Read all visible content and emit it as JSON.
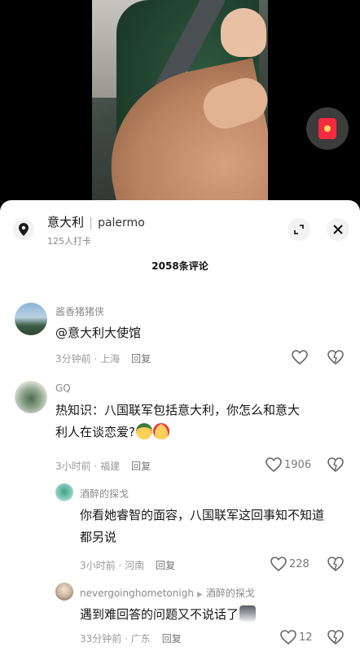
{
  "location": {
    "name": "意大利",
    "sub": "palermo",
    "checkins": "125人打卡"
  },
  "comment_count": "2058条评论",
  "comments": [
    {
      "user": "酱香猪猪侠",
      "text": "@意大利大使馆",
      "meta": "3分钟前 · 上海",
      "reply": "回复",
      "likes": ""
    },
    {
      "user": "GQ",
      "text": "热知识：八国联军包括意大利，你怎么和意大利人在谈恋爱?",
      "meta": "3小时前 · 福建",
      "reply": "回复",
      "likes": "1906"
    },
    {
      "user": "酒醉的探戈",
      "text": "你看她睿智的面容，八国联军这回事知不知道都另说",
      "meta": "3小时前 · 河南",
      "reply": "回复",
      "likes": "228"
    },
    {
      "user": "nevergoinghometonigh",
      "reply_to": "酒醉的探戈",
      "text": "遇到难回答的问题又不说话了",
      "meta": "33分钟前 · 广东",
      "reply": "回复",
      "likes": "12"
    }
  ],
  "colors": {
    "accent_red": "#f22c3d",
    "panel_bg": "#ffffff",
    "meta_gray": "#9a9a9a"
  },
  "icons": [
    "location-pin-icon",
    "expand-icon",
    "close-icon",
    "heart-icon",
    "dislike-heart-icon",
    "red-packet-icon",
    "play-triangle-icon"
  ]
}
